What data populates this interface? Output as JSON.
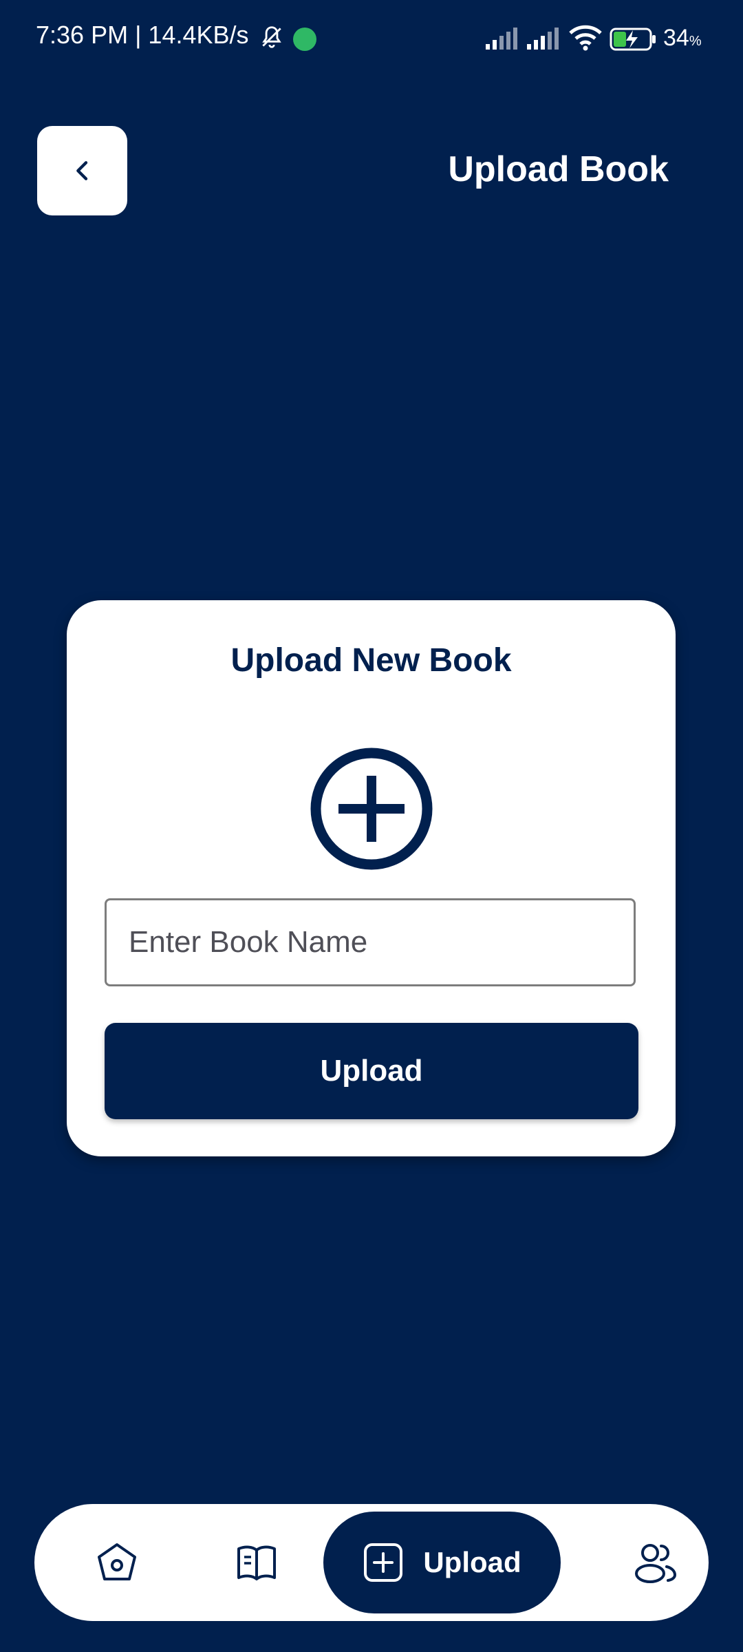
{
  "status_bar": {
    "time_speed": "7:36 PM | 14.4KB/s",
    "battery_percent": "34",
    "battery_unit": "%"
  },
  "header": {
    "title": "Upload Book"
  },
  "card": {
    "title": "Upload New Book",
    "book_name_placeholder": "Enter Book Name",
    "book_name_value": "",
    "upload_label": "Upload"
  },
  "bottom_nav": {
    "active_label": "Upload",
    "items": [
      "home-icon",
      "book-icon",
      "upload-icon",
      "users-icon"
    ]
  },
  "colors": {
    "background": "#01204e",
    "accent": "#01204e",
    "surface": "#ffffff"
  }
}
